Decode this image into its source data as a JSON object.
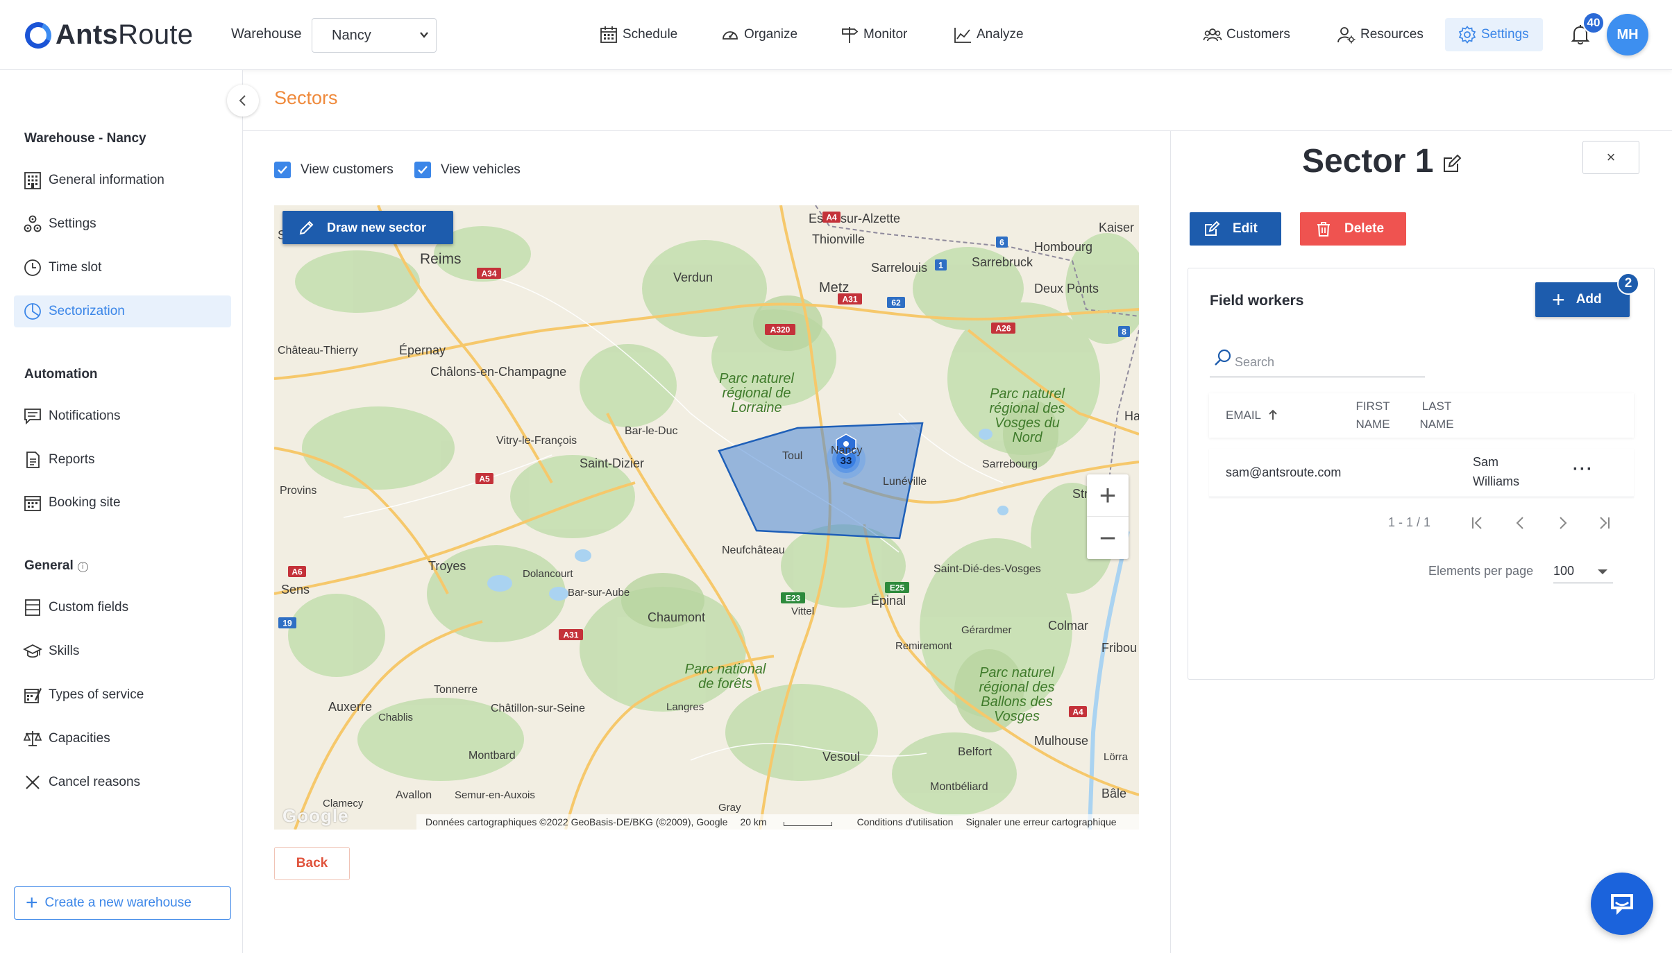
{
  "brand": {
    "name_bold": "Ants",
    "name_rest": "Route"
  },
  "header": {
    "warehouse_label": "Warehouse",
    "warehouse_value": "Nancy",
    "nav": [
      "Schedule",
      "Organize",
      "Monitor",
      "Analyze",
      "Customers",
      "Resources",
      "Settings"
    ],
    "notifications_count": "40",
    "avatar_initials": "MH"
  },
  "sidebar": {
    "warehouse_heading": "Warehouse - Nancy",
    "warehouse_items": [
      "General information",
      "Settings",
      "Time slot",
      "Sectorization"
    ],
    "automation_heading": "Automation",
    "automation_items": [
      "Notifications",
      "Reports",
      "Booking site"
    ],
    "general_heading": "General",
    "general_items": [
      "Custom fields",
      "Skills",
      "Types of service",
      "Capacities",
      "Cancel reasons"
    ],
    "create_button": "Create a new warehouse"
  },
  "main": {
    "title": "Sectors",
    "view_customers": "View customers",
    "view_vehicles": "View vehicles",
    "draw_button": "Draw new sector",
    "back_button": "Back"
  },
  "map": {
    "cluster_count": "33",
    "footer": {
      "data": "Données cartographiques ©2022 GeoBasis-DE/BKG (©2009), Google",
      "scale": "20 km",
      "terms": "Conditions d'utilisation",
      "report": "Signaler une erreur cartographique"
    },
    "places": [
      {
        "name": "Soissons"
      },
      {
        "name": "Reims"
      },
      {
        "name": "Verdun"
      },
      {
        "name": "Metz"
      },
      {
        "name": "Thionville"
      },
      {
        "name": "Esch-sur-Alzette"
      },
      {
        "name": "Sarrelouis"
      },
      {
        "name": "Sarrebruck"
      },
      {
        "name": "Hombourg"
      },
      {
        "name": "Deux Ponts"
      },
      {
        "name": "Kaiser"
      },
      {
        "name": "Château-Thierry"
      },
      {
        "name": "Épernay"
      },
      {
        "name": "Châlons-en-Champagne"
      },
      {
        "name": "Vitry-le-François"
      },
      {
        "name": "Bar-le-Duc"
      },
      {
        "name": "Saint-Dizier"
      },
      {
        "name": "Toul"
      },
      {
        "name": "Nancy"
      },
      {
        "name": "Lunéville"
      },
      {
        "name": "Sarrebourg"
      },
      {
        "name": "Provins"
      },
      {
        "name": "Troyes"
      },
      {
        "name": "Sens"
      },
      {
        "name": "Neufchâteau"
      },
      {
        "name": "Dolancourt"
      },
      {
        "name": "Bar-sur-Aube"
      },
      {
        "name": "Chaumont"
      },
      {
        "name": "Vittel"
      },
      {
        "name": "Épinal"
      },
      {
        "name": "Saint-Dié-des-Vosges"
      },
      {
        "name": "Gérardmer"
      },
      {
        "name": "Colmar"
      },
      {
        "name": "Remiremont"
      },
      {
        "name": "Fribou"
      },
      {
        "name": "Tonnerre"
      },
      {
        "name": "Auxerre"
      },
      {
        "name": "Chablis"
      },
      {
        "name": "Châtillon-sur-Seine"
      },
      {
        "name": "Langres"
      },
      {
        "name": "Montbard"
      },
      {
        "name": "Vesoul"
      },
      {
        "name": "Belfort"
      },
      {
        "name": "Mulhouse"
      },
      {
        "name": "Lörra"
      },
      {
        "name": "Bâle"
      },
      {
        "name": "Montbéliard"
      },
      {
        "name": "Avallon"
      },
      {
        "name": "Semur-en-Auxois"
      },
      {
        "name": "Clamecy"
      },
      {
        "name": "Gray"
      },
      {
        "name": "Ha"
      },
      {
        "name": "Str"
      }
    ],
    "parks": [
      {
        "name": "Parc naturel régional de Lorraine"
      },
      {
        "name": "Parc naturel régional des Vosges du Nord"
      },
      {
        "name": "Parc national de forêts"
      },
      {
        "name": "Parc naturel régional des Ballons des Vosges"
      }
    ],
    "roads": [
      "A4",
      "A34",
      "A31",
      "A320",
      "A26",
      "A5",
      "A6",
      "A31",
      "E23",
      "E25",
      "A4",
      "8",
      "1",
      "6",
      "62",
      "19"
    ]
  },
  "sector": {
    "title": "Sector 1",
    "edit_button": "Edit",
    "delete_button": "Delete",
    "close_label": "×",
    "field_workers": {
      "title": "Field workers",
      "add_button": "Add",
      "add_badge": "2",
      "search_placeholder": "Search",
      "columns": {
        "email": "EMAIL",
        "first_1": "FIRST",
        "first_2": "NAME",
        "last_1": "LAST",
        "last_2": "NAME"
      },
      "rows": [
        {
          "email": "sam@antsroute.com",
          "first_name": "Sam",
          "last_name": "Williams"
        }
      ],
      "pagination": "1 - 1 / 1",
      "per_page_label": "Elements per page",
      "per_page_value": "100"
    }
  },
  "colors": {
    "accent": "#1d5cad",
    "settings_active": "#3b86e8",
    "delete": "#ef5350",
    "title_orange": "#ef8a3c"
  }
}
